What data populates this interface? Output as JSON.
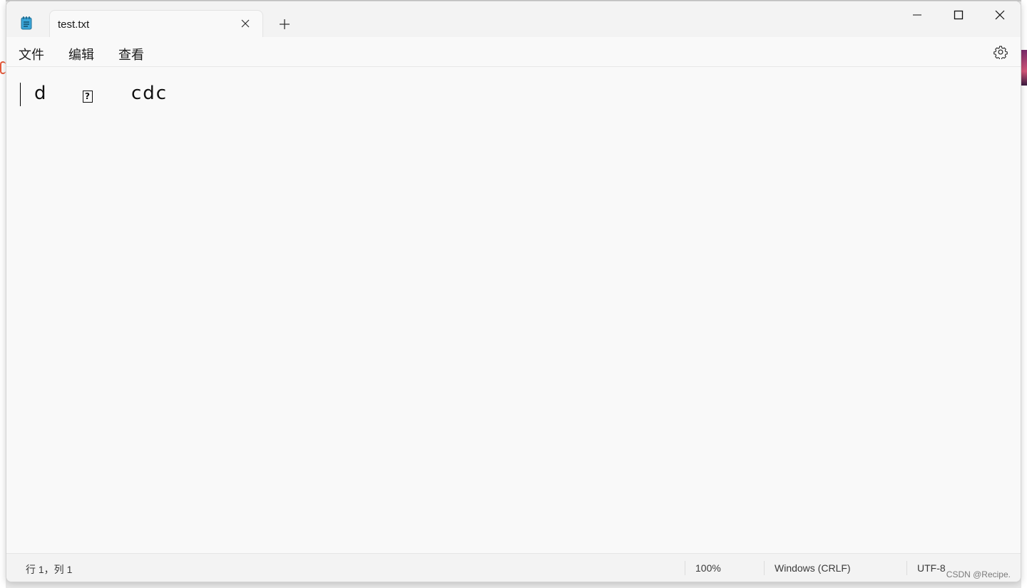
{
  "window": {
    "tab_title": "test.txt",
    "new_tab_symbol": "+"
  },
  "menu": {
    "file": "文件",
    "edit": "编辑",
    "view": "查看"
  },
  "editor": {
    "char1": "d",
    "char2": "?",
    "char3": "cdc"
  },
  "status": {
    "position": "行 1，列 1",
    "zoom": "100%",
    "line_ending": "Windows (CRLF)",
    "encoding": "UTF-8"
  },
  "watermark": "CSDN @Recipe.",
  "icons": {
    "app": "notepad-icon",
    "close_tab": "close-icon",
    "new_tab": "plus-icon",
    "minimize": "minimize-icon",
    "maximize": "maximize-icon",
    "close_window": "close-icon",
    "settings": "gear-icon"
  },
  "colors": {
    "window_bg": "#f9f9f9",
    "titlebar_bg": "#f3f3f3",
    "app_icon": "#3aa6d9"
  }
}
